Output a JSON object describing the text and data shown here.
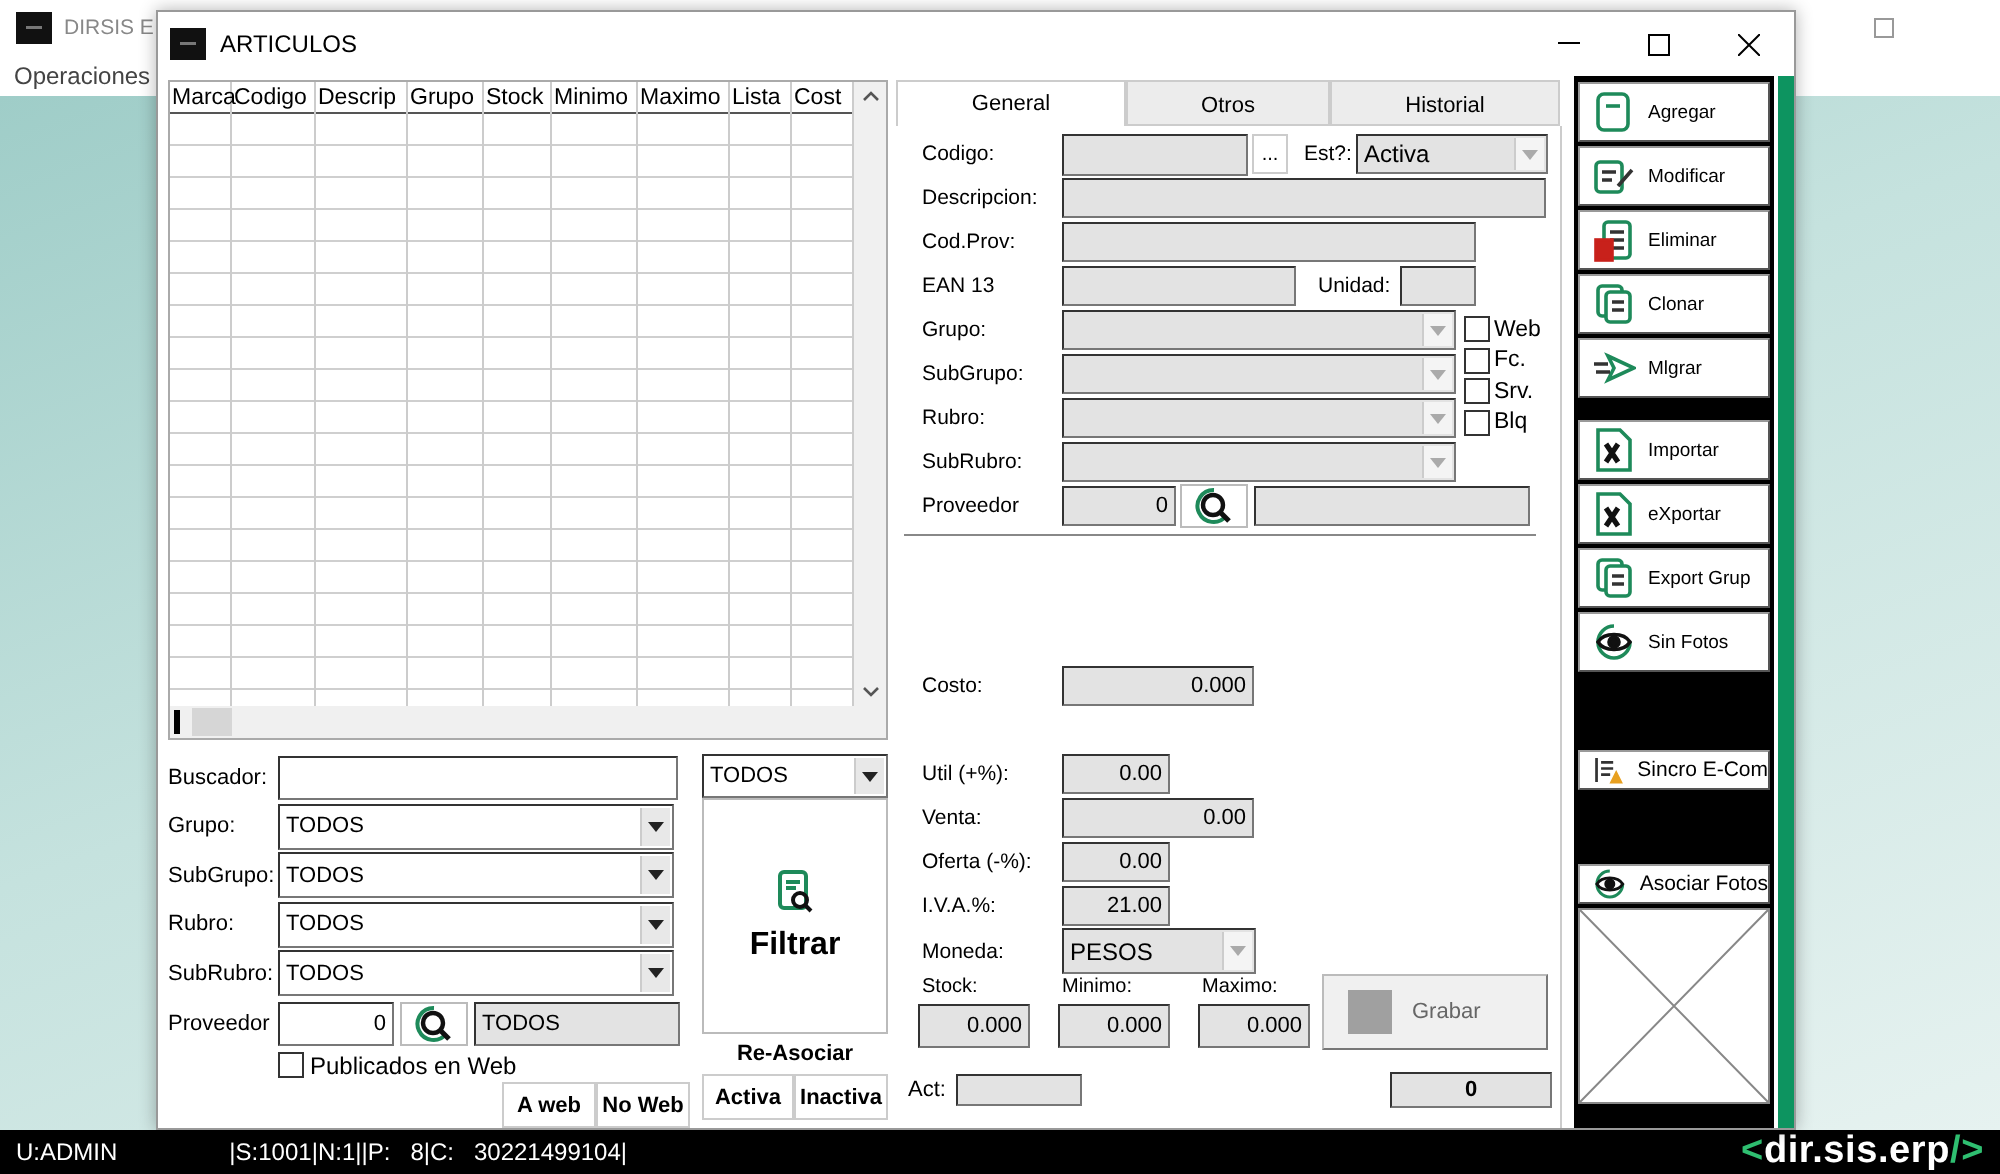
{
  "app": {
    "title": "DIRSIS E",
    "menu": [
      "Operaciones"
    ]
  },
  "window": {
    "title": "ARTICULOS"
  },
  "grid": {
    "columns": [
      "Marca",
      "Codigo",
      "Descrip",
      "Grupo",
      "Stock",
      "Minimo",
      "Maximo",
      "Lista",
      "Cost"
    ]
  },
  "filters": {
    "search_label": "Buscador:",
    "mode": "TODOS",
    "rows": [
      {
        "label": "Grupo:",
        "value": "TODOS"
      },
      {
        "label": "SubGrupo:",
        "value": "TODOS"
      },
      {
        "label": "Rubro:",
        "value": "TODOS"
      },
      {
        "label": "SubRubro:",
        "value": "TODOS"
      }
    ],
    "proveedor": {
      "label": "Proveedor",
      "value": "0",
      "name": "TODOS"
    },
    "published": {
      "label": "Publicados en Web",
      "checked": false
    },
    "filter_button": "Filtrar",
    "reassociate_label": "Re-Asociar",
    "web_buttons": [
      "A web",
      "No Web"
    ],
    "state_buttons": [
      "Activa",
      "Inactiva"
    ]
  },
  "form": {
    "tabs": [
      {
        "label": "General",
        "selected": true
      },
      {
        "label": "Otros",
        "selected": false
      },
      {
        "label": "Historial",
        "selected": false
      }
    ],
    "codigo_label": "Codigo:",
    "more_button": "...",
    "estado_label": "Est?:",
    "estado_value": "Activa",
    "descripcion_label": "Descripcion:",
    "codprov_label": "Cod.Prov:",
    "ean_label": "EAN 13",
    "unidad_label": "Unidad:",
    "selects": [
      {
        "label": "Grupo:"
      },
      {
        "label": "SubGrupo:"
      },
      {
        "label": "Rubro:"
      },
      {
        "label": "SubRubro:"
      }
    ],
    "flags": [
      {
        "label": "Web",
        "checked": false
      },
      {
        "label": "Fc.",
        "checked": false
      },
      {
        "label": "Srv.",
        "checked": false
      },
      {
        "label": "Blq",
        "checked": false
      }
    ],
    "proveedor": {
      "label": "Proveedor",
      "value": "0"
    },
    "costo": {
      "label": "Costo:",
      "value": "0.000"
    },
    "prices": [
      {
        "label": "Util (+%):",
        "value": "0.00",
        "kind": "short"
      },
      {
        "label": "Venta:",
        "value": "0.00",
        "kind": "long"
      },
      {
        "label": "Oferta (-%):",
        "value": "0.00",
        "kind": "short"
      },
      {
        "label": "I.V.A.%:",
        "value": "21.00",
        "kind": "short"
      }
    ],
    "moneda": {
      "label": "Moneda:",
      "value": "PESOS"
    },
    "stock": [
      {
        "label": "Stock:",
        "value": "0.000"
      },
      {
        "label": "Minimo:",
        "value": "0.000"
      },
      {
        "label": "Maximo:",
        "value": "0.000"
      }
    ],
    "save_button": "Grabar",
    "act_label": "Act:",
    "counter": "0"
  },
  "actions": [
    [
      {
        "label": "Agregar"
      },
      {
        "label": "Modificar"
      },
      {
        "label": "Eliminar"
      },
      {
        "label": "Clonar"
      },
      {
        "label": "Mlgrar"
      }
    ],
    [
      {
        "label": "Importar"
      },
      {
        "label": "eXportar"
      },
      {
        "label": "Export Grup"
      },
      {
        "label": "Sin Fotos"
      }
    ],
    [
      {
        "label": "Sincro E-Com"
      }
    ],
    [
      {
        "label": "Asociar Fotos"
      }
    ]
  ],
  "status_bar": {
    "user": "U:ADMIN",
    "info": "|S:1001|N:1||P:   8|C:   30221499104|",
    "logo": {
      "open": "<",
      "name": "dir.sis.erp",
      "close": "/>"
    }
  }
}
